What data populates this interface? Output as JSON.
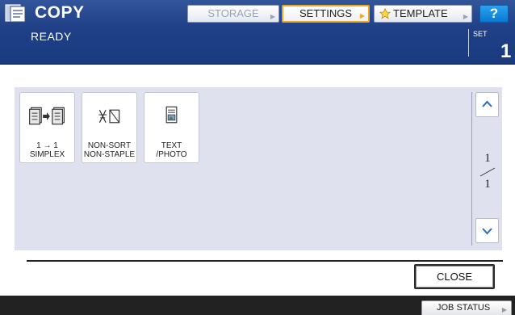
{
  "header": {
    "title": "COPY",
    "app_icon": "copier-icon",
    "buttons": {
      "storage": "STORAGE",
      "settings": "SETTINGS",
      "template": "TEMPLATE",
      "help": "?"
    },
    "status": "READY",
    "set_label": "SET",
    "set_value": "1"
  },
  "panel": {
    "functions": [
      {
        "label": "1 → 1\nSIMPLEX",
        "icon": "simplex-copy-icon"
      },
      {
        "label": "NON-SORT\nNON-STAPLE",
        "icon": "non-sort-non-staple-icon"
      },
      {
        "label": "TEXT\n/PHOTO",
        "icon": "text-photo-icon"
      }
    ],
    "page_current": "1",
    "page_total": "1"
  },
  "bottom": {
    "close": "CLOSE",
    "job_status": "JOB STATUS"
  },
  "colors": {
    "header_blue": "#1f3f86",
    "settings_highlight": "#f2a51f",
    "help_blue": "#0a78d2",
    "panel_bg": "#dfe2ee",
    "footer_dark": "#222222"
  }
}
